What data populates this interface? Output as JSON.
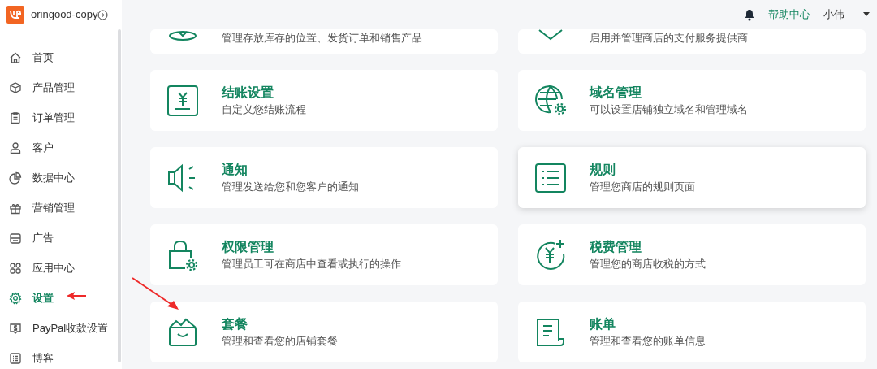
{
  "store": {
    "name": "oringood-copy"
  },
  "sidebar": {
    "items": [
      {
        "label": "首页",
        "selected": false
      },
      {
        "label": "产品管理",
        "selected": false
      },
      {
        "label": "订单管理",
        "selected": false
      },
      {
        "label": "客户",
        "selected": false
      },
      {
        "label": "数据中心",
        "selected": false
      },
      {
        "label": "营销管理",
        "selected": false
      },
      {
        "label": "广告",
        "selected": false
      },
      {
        "label": "应用中心",
        "selected": false
      },
      {
        "label": "设置",
        "selected": true
      },
      {
        "label": "PayPal收款设置",
        "selected": false
      },
      {
        "label": "博客",
        "selected": false
      }
    ]
  },
  "header": {
    "help": "帮助中心",
    "user": "小伟"
  },
  "cards": [
    {
      "description": "管理存放库存的位置、发货订单和销售产品",
      "hovered": false
    },
    {
      "description": "启用并管理商店的支付服务提供商",
      "hovered": false
    },
    {
      "title": "结账设置",
      "description": "自定义您结账流程",
      "hovered": false
    },
    {
      "title": "域名管理",
      "description": "可以设置店铺独立域名和管理域名",
      "hovered": false
    },
    {
      "title": "通知",
      "description": "管理发送给您和您客户的通知",
      "hovered": false
    },
    {
      "title": "规则",
      "description": "管理您商店的规则页面",
      "hovered": true
    },
    {
      "title": "权限管理",
      "description": "管理员工可在商店中查看或执行的操作",
      "hovered": false
    },
    {
      "title": "税费管理",
      "description": "管理您的商店收税的方式",
      "hovered": false
    },
    {
      "title": "套餐",
      "description": "管理和查看您的店铺套餐",
      "hovered": false
    },
    {
      "title": "账单",
      "description": "管理和查看您的账单信息",
      "hovered": false
    }
  ]
}
